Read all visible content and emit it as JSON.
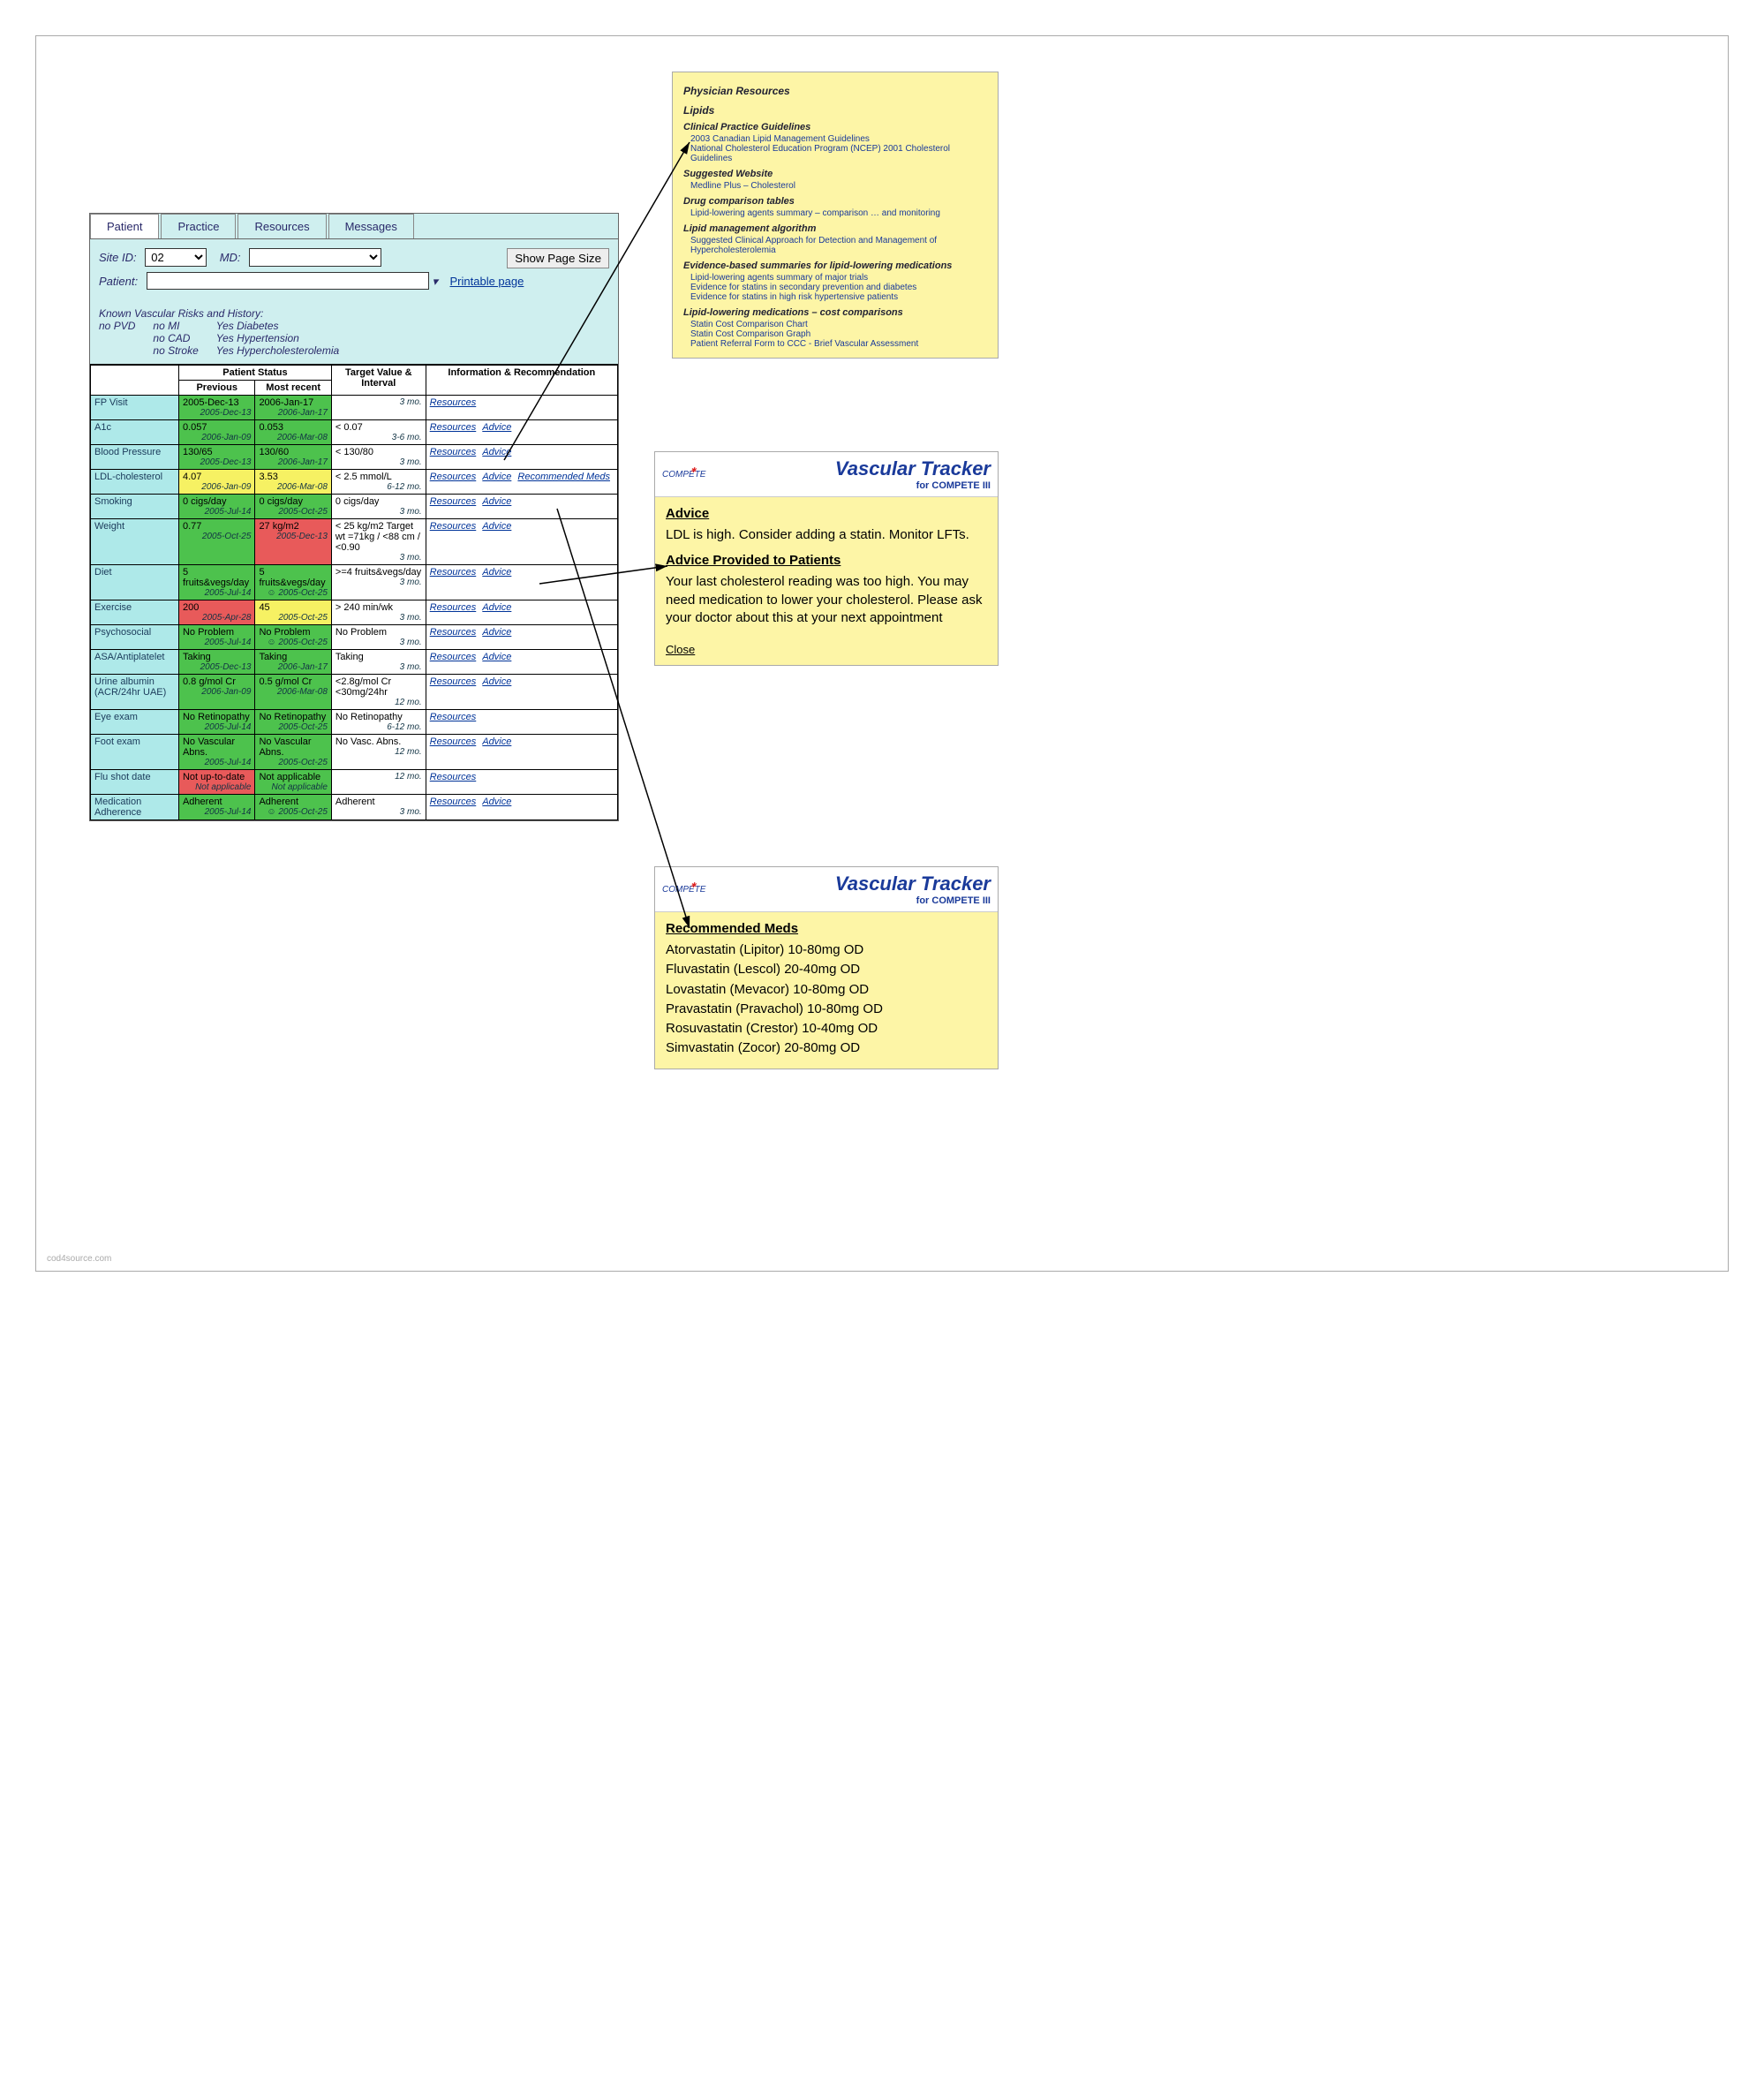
{
  "tabs": [
    "Patient",
    "Practice",
    "Resources",
    "Messages"
  ],
  "filters": {
    "siteIdLabel": "Site ID:",
    "siteIdValue": "02",
    "mdLabel": "MD:",
    "showPageBtn": "Show Page Size",
    "patientLabel": "Patient:",
    "printableLink": "Printable page"
  },
  "risks": {
    "heading": "Known Vascular Risks and History:",
    "items": [
      {
        "v": "no",
        "l": "PVD"
      },
      {
        "v": "no",
        "l": "MI"
      },
      {
        "v": "no",
        "l": "CAD"
      },
      {
        "v": "no",
        "l": "Stroke"
      },
      {
        "v": "Yes",
        "l": "Diabetes"
      },
      {
        "v": "Yes",
        "l": "Hypertension"
      },
      {
        "v": "Yes",
        "l": "Hypercholesterolemia"
      }
    ]
  },
  "tableHeaders": {
    "status": "Patient Status",
    "previous": "Previous",
    "recent": "Most recent",
    "target": "Target Value & Interval",
    "info": "Information & Recommendation"
  },
  "rows": [
    {
      "label": "FP Visit",
      "prev": {
        "v": "2005-Dec-13",
        "d": "2005-Dec-13",
        "c": "green"
      },
      "recent": {
        "v": "2006-Jan-17",
        "d": "2006-Jan-17",
        "c": "green"
      },
      "target": {
        "v": "",
        "int": "3 mo."
      },
      "links": [
        "Resources"
      ]
    },
    {
      "label": "A1c",
      "prev": {
        "v": "0.057",
        "d": "2006-Jan-09",
        "c": "green"
      },
      "recent": {
        "v": "0.053",
        "d": "2006-Mar-08",
        "c": "green"
      },
      "target": {
        "v": "< 0.07",
        "int": "3-6 mo."
      },
      "links": [
        "Resources",
        "Advice"
      ]
    },
    {
      "label": "Blood Pressure",
      "prev": {
        "v": "130/65",
        "d": "2005-Dec-13",
        "c": "green"
      },
      "recent": {
        "v": "130/60",
        "d": "2006-Jan-17",
        "c": "green"
      },
      "target": {
        "v": "< 130/80",
        "int": "3 mo."
      },
      "links": [
        "Resources",
        "Advice"
      ]
    },
    {
      "label": "LDL-cholesterol",
      "prev": {
        "v": "4.07",
        "d": "2006-Jan-09",
        "c": "yellow"
      },
      "recent": {
        "v": "3.53",
        "d": "2006-Mar-08",
        "c": "yellow"
      },
      "target": {
        "v": "< 2.5 mmol/L",
        "int": "6-12 mo."
      },
      "links": [
        "Resources",
        "Advice",
        "Recommended Meds"
      ]
    },
    {
      "label": "Smoking",
      "prev": {
        "v": "0 cigs/day",
        "d": "2005-Jul-14",
        "c": "green"
      },
      "recent": {
        "v": "0 cigs/day",
        "d": "2005-Oct-25",
        "c": "green"
      },
      "target": {
        "v": "0 cigs/day",
        "int": "3 mo."
      },
      "links": [
        "Resources",
        "Advice"
      ]
    },
    {
      "label": "Weight",
      "prev": {
        "v": "0.77",
        "d": "2005-Oct-25",
        "c": "green"
      },
      "recent": {
        "v": "27 kg/m2",
        "d": "2005-Dec-13",
        "c": "red"
      },
      "target": {
        "v": "< 25 kg/m2 Target wt =71kg / <88 cm / <0.90",
        "int": "3 mo."
      },
      "links": [
        "Resources",
        "Advice"
      ]
    },
    {
      "label": "Diet",
      "prev": {
        "v": "5 fruits&vegs/day",
        "d": "2005-Jul-14",
        "c": "green"
      },
      "recent": {
        "v": "5 fruits&vegs/day",
        "d": "☺ 2005-Oct-25",
        "c": "green"
      },
      "target": {
        "v": ">=4 fruits&vegs/day",
        "int": "3 mo."
      },
      "links": [
        "Resources",
        "Advice"
      ]
    },
    {
      "label": "Exercise",
      "prev": {
        "v": "200",
        "d": "2005-Apr-28",
        "c": "red"
      },
      "recent": {
        "v": "45",
        "d": "2005-Oct-25",
        "c": "yellow"
      },
      "target": {
        "v": "> 240 min/wk",
        "int": "3 mo."
      },
      "links": [
        "Resources",
        "Advice"
      ]
    },
    {
      "label": "Psychosocial",
      "prev": {
        "v": "No Problem",
        "d": "2005-Jul-14",
        "c": "green"
      },
      "recent": {
        "v": "No Problem",
        "d": "☺ 2005-Oct-25",
        "c": "green"
      },
      "target": {
        "v": "No Problem",
        "int": "3 mo."
      },
      "links": [
        "Resources",
        "Advice"
      ]
    },
    {
      "label": "ASA/Antiplatelet",
      "prev": {
        "v": "Taking",
        "d": "2005-Dec-13",
        "c": "green"
      },
      "recent": {
        "v": "Taking",
        "d": "2006-Jan-17",
        "c": "green"
      },
      "target": {
        "v": "Taking",
        "int": "3 mo."
      },
      "links": [
        "Resources",
        "Advice"
      ]
    },
    {
      "label": "Urine albumin (ACR/24hr UAE)",
      "prev": {
        "v": "0.8 g/mol Cr",
        "d": "2006-Jan-09",
        "c": "green"
      },
      "recent": {
        "v": "0.5 g/mol Cr",
        "d": "2006-Mar-08",
        "c": "green"
      },
      "target": {
        "v": "<2.8g/mol Cr <30mg/24hr",
        "int": "12 mo."
      },
      "links": [
        "Resources",
        "Advice"
      ]
    },
    {
      "label": "Eye exam",
      "prev": {
        "v": "No Retinopathy",
        "d": "2005-Jul-14",
        "c": "green"
      },
      "recent": {
        "v": "No Retinopathy",
        "d": "2005-Oct-25",
        "c": "green"
      },
      "target": {
        "v": "No Retinopathy",
        "int": "6-12 mo."
      },
      "links": [
        "Resources"
      ]
    },
    {
      "label": "Foot exam",
      "prev": {
        "v": "No Vascular Abns.",
        "d": "2005-Jul-14",
        "c": "green"
      },
      "recent": {
        "v": "No Vascular Abns.",
        "d": "2005-Oct-25",
        "c": "green"
      },
      "target": {
        "v": "No Vasc. Abns.",
        "int": "12 mo."
      },
      "links": [
        "Resources",
        "Advice"
      ]
    },
    {
      "label": "Flu shot date",
      "prev": {
        "v": "Not up-to-date",
        "d": "Not applicable",
        "c": "red"
      },
      "recent": {
        "v": "Not applicable",
        "d": "Not applicable",
        "c": "green"
      },
      "target": {
        "v": "",
        "int": "12 mo."
      },
      "links": [
        "Resources"
      ]
    },
    {
      "label": "Medication Adherence",
      "prev": {
        "v": "Adherent",
        "d": "2005-Jul-14",
        "c": "green"
      },
      "recent": {
        "v": "Adherent",
        "d": "☺ 2005-Oct-25",
        "c": "green"
      },
      "target": {
        "v": "Adherent",
        "int": "3 mo."
      },
      "links": [
        "Resources",
        "Advice"
      ]
    }
  ],
  "resourcesPanel": {
    "title": "Physician Resources",
    "groups": [
      {
        "h": "Lipids",
        "sub": "Clinical Practice Guidelines",
        "links": [
          "2003 Canadian Lipid Management Guidelines",
          "National Cholesterol Education Program (NCEP) 2001 Cholesterol Guidelines"
        ]
      },
      {
        "sub": "Suggested Website",
        "links": [
          "Medline Plus – Cholesterol"
        ]
      },
      {
        "sub": "Drug comparison tables",
        "links": [
          "Lipid-lowering agents summary – comparison … and monitoring"
        ]
      },
      {
        "sub": "Lipid management algorithm",
        "links": [
          "Suggested Clinical Approach for Detection and Management of Hypercholesterolemia"
        ]
      },
      {
        "sub": "Evidence-based summaries for lipid-lowering medications",
        "links": [
          "Lipid-lowering agents summary of major trials",
          "Evidence for statins in secondary prevention and diabetes",
          "Evidence for statins in high risk hypertensive patients"
        ]
      },
      {
        "sub": "Lipid-lowering medications – cost comparisons",
        "links": [
          "Statin Cost Comparison Chart",
          "Statin Cost Comparison Graph"
        ]
      },
      {
        "sub": "",
        "links": [
          "Patient Referral Form to CCC - Brief Vascular Assessment"
        ]
      }
    ]
  },
  "advicePanel": {
    "trackerTitle": "Vascular Tracker",
    "trackerSub": "for COMPETE III",
    "logo": "COMPETE",
    "h1": "Advice",
    "p1": "LDL is high. Consider adding a statin. Monitor LFTs.",
    "h2": "Advice Provided to Patients",
    "p2": "Your last cholesterol reading was too high. You may need medication to lower your cholesterol. Please ask your doctor about this at your next appointment",
    "close": "Close"
  },
  "medsPanel": {
    "trackerTitle": "Vascular Tracker",
    "trackerSub": "for COMPETE III",
    "logo": "COMPETE",
    "h1": "Recommended Meds",
    "meds": [
      "Atorvastatin (Lipitor) 10-80mg OD",
      "Fluvastatin (Lescol) 20-40mg OD",
      "Lovastatin (Mevacor) 10-80mg OD",
      "Pravastatin (Pravachol) 10-80mg OD",
      "Rosuvastatin (Crestor) 10-40mg OD",
      "Simvastatin (Zocor) 20-80mg OD"
    ]
  },
  "watermark": "cod4source.com"
}
